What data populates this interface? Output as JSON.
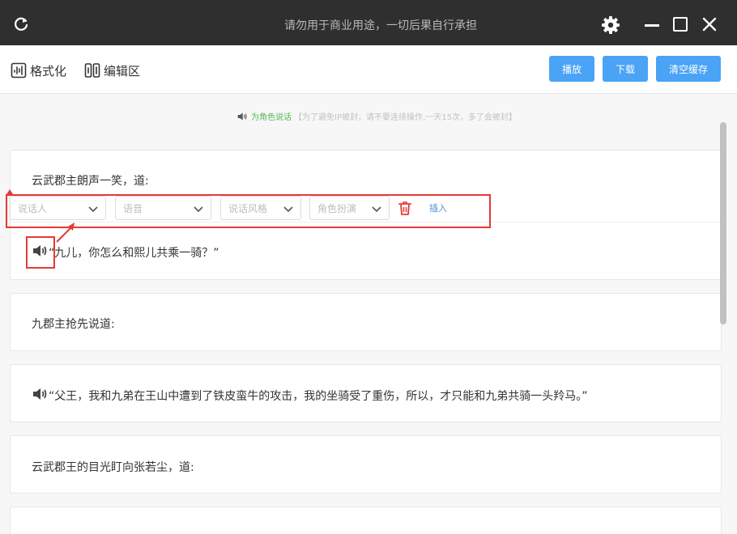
{
  "titlebar": {
    "title": "请勿用于商业用途，一切后果自行承担",
    "background": "#2f2f2f",
    "icons": [
      "refresh-icon",
      "gear-icon",
      "minimize-icon",
      "maximize-icon",
      "close-icon"
    ]
  },
  "toolbar": {
    "format_label": "格式化",
    "edit_label": "编辑区",
    "play_label": "播放",
    "download_label": "下载",
    "clear_cache_label": "清空缓存",
    "button_color": "#4aa3f5"
  },
  "notice": {
    "highlight": "为角色说话",
    "text": "【为了避免IP被封，请不要连续操作,一天15次，多了会被封】"
  },
  "paragraphs": [
    {
      "text": "云武郡主朗声一笑，道:"
    },
    {
      "text": "“九儿，你怎么和熙儿共乘一骑？”"
    },
    {
      "text": "九郡主抢先说道:"
    },
    {
      "text": "“父王，我和九弟在王山中遭到了铁皮蛮牛的攻击，我的坐骑受了重伤，所以，才只能和九弟共骑一头羚马。”"
    },
    {
      "text": "云武郡王的目光盯向张若尘，道:"
    }
  ],
  "controls": {
    "speaker_placeholder": "说话人",
    "voice_placeholder": "语音",
    "style_placeholder": "说话风格",
    "role_placeholder": "角色扮演",
    "insert_label": "插入"
  },
  "colors": {
    "highlight_red": "#e53935",
    "link_blue": "#4a8fd6",
    "notice_green": "#55b655"
  }
}
